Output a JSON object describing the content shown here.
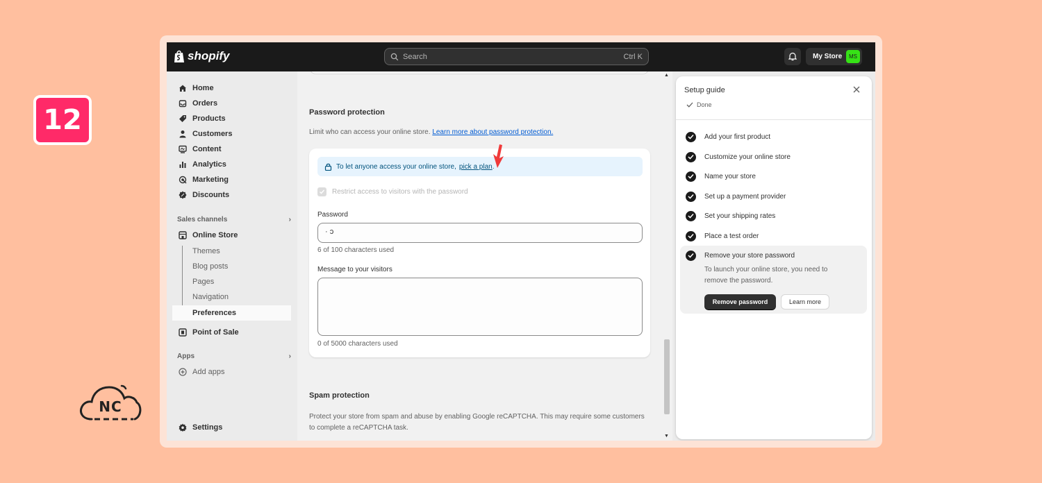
{
  "step_number": "12",
  "watermark": {
    "text": "NC"
  },
  "topbar": {
    "brand": "shopify",
    "search_placeholder": "Search",
    "search_shortcut": "Ctrl K",
    "store_name": "My Store",
    "avatar_initials": "MS"
  },
  "sidebar": {
    "items": [
      {
        "label": "Home",
        "icon": "home-icon"
      },
      {
        "label": "Orders",
        "icon": "orders-icon"
      },
      {
        "label": "Products",
        "icon": "tag-icon"
      },
      {
        "label": "Customers",
        "icon": "person-icon"
      },
      {
        "label": "Content",
        "icon": "content-icon"
      },
      {
        "label": "Analytics",
        "icon": "bar-chart-icon"
      },
      {
        "label": "Marketing",
        "icon": "target-icon"
      },
      {
        "label": "Discounts",
        "icon": "discount-icon"
      }
    ],
    "sales_channels_label": "Sales channels",
    "online_store": "Online Store",
    "sub_items": [
      "Themes",
      "Blog posts",
      "Pages",
      "Navigation",
      "Preferences"
    ],
    "point_of_sale": "Point of Sale",
    "apps_label": "Apps",
    "add_apps": "Add apps",
    "settings": "Settings"
  },
  "main": {
    "password_section": {
      "title": "Password protection",
      "description": "Limit who can access your online store.",
      "learn_more_link": "Learn more about password protection.",
      "banner_text": "To let anyone access your online store,",
      "banner_link": "pick a plan",
      "banner_suffix": ".",
      "checkbox_label": "Restrict access to visitors with the password",
      "password_label": "Password",
      "password_value": "  ·       ɔ",
      "password_help": "6 of 100 characters used",
      "message_label": "Message to your visitors",
      "message_value": "",
      "message_help": "0 of 5000 characters used"
    },
    "spam_section": {
      "title": "Spam protection",
      "description": "Protect your store from spam and abuse by enabling Google reCAPTCHA. This may require some customers to complete a reCAPTCHA task."
    }
  },
  "setup_guide": {
    "title": "Setup guide",
    "status": "Done",
    "tasks": [
      "Add your first product",
      "Customize your online store",
      "Name your store",
      "Set up a payment provider",
      "Set your shipping rates",
      "Place a test order",
      "Remove your store password"
    ],
    "active_task_description": "To launch your online store, you need to remove the password.",
    "primary_button": "Remove password",
    "secondary_button": "Learn more"
  },
  "colors": {
    "background": "#ffbf9f",
    "badge": "#ff2a68",
    "topbar": "#1a1a1a",
    "link": "#005bd3",
    "avatar": "#36e216",
    "arrow": "#f03a3a"
  }
}
